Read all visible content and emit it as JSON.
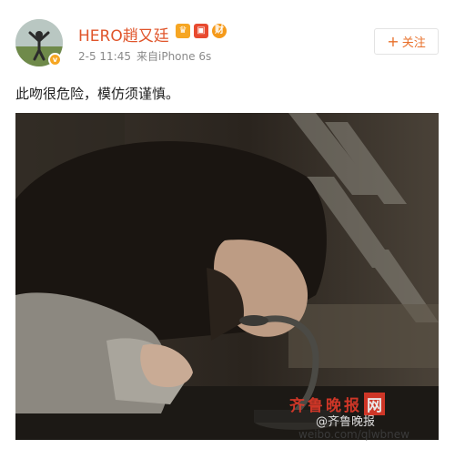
{
  "author": {
    "name": "HERO趙又廷",
    "badges": [
      "vip-crown-icon",
      "red-envelope-icon",
      "cai-icon"
    ],
    "badge_glyphs": [
      "♛",
      "▣",
      "财"
    ]
  },
  "meta": {
    "timestamp": "2-5 11:45",
    "source": "来自iPhone 6s"
  },
  "follow": {
    "plus": "+",
    "label": "关注"
  },
  "post": {
    "text": "此吻很危险，模仿须谨慎。"
  },
  "watermark": {
    "logo": "齐鲁晚报",
    "logo_net": "网",
    "weibo": "@齐鲁晚报",
    "site": "weibo.com/qlwbnew"
  },
  "colors": {
    "username": "#e0552b",
    "follow": "#e8702a",
    "meta": "#8a8a8a"
  }
}
